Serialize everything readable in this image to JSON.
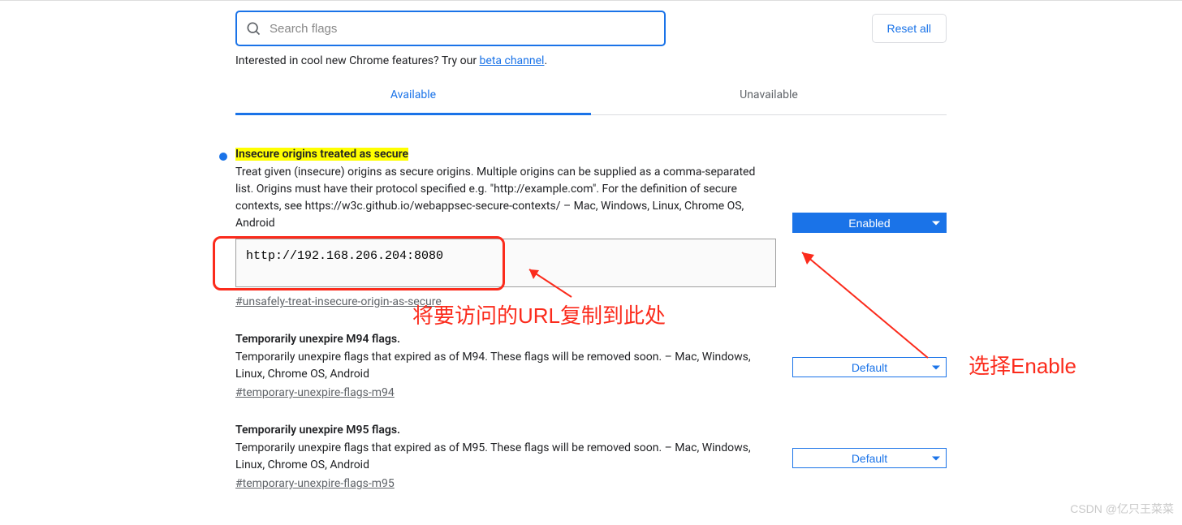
{
  "search": {
    "placeholder": "Search flags"
  },
  "reset_button": "Reset all",
  "promo": {
    "text": "Interested in cool new Chrome features? Try our ",
    "link": "beta channel"
  },
  "tabs": {
    "available": "Available",
    "unavailable": "Unavailable"
  },
  "flags": [
    {
      "title": "Insecure origins treated as secure",
      "desc": "Treat given (insecure) origins as secure origins. Multiple origins can be supplied as a comma-separated list. Origins must have their protocol specified e.g. \"http://example.com\". For the definition of secure contexts, see https://w3c.github.io/webappsec-secure-contexts/ – Mac, Windows, Linux, Chrome OS, Android",
      "textarea_value": "http://192.168.206.204:8080",
      "anchor": "#unsafely-treat-insecure-origin-as-secure",
      "select": "Enabled",
      "highlighted": true,
      "has_dot": true
    },
    {
      "title": "Temporarily unexpire M94 flags.",
      "desc": "Temporarily unexpire flags that expired as of M94. These flags will be removed soon. – Mac, Windows, Linux, Chrome OS, Android",
      "anchor": "#temporary-unexpire-flags-m94",
      "select": "Default"
    },
    {
      "title": "Temporarily unexpire M95 flags.",
      "desc": "Temporarily unexpire flags that expired as of M95. These flags will be removed soon. – Mac, Windows, Linux, Chrome OS, Android",
      "anchor": "#temporary-unexpire-flags-m95",
      "select": "Default"
    }
  ],
  "annotations": {
    "url_note": "将要访问的URL复制到此处",
    "enable_note": "选择Enable"
  },
  "watermark": "CSDN @亿只王菜菜"
}
